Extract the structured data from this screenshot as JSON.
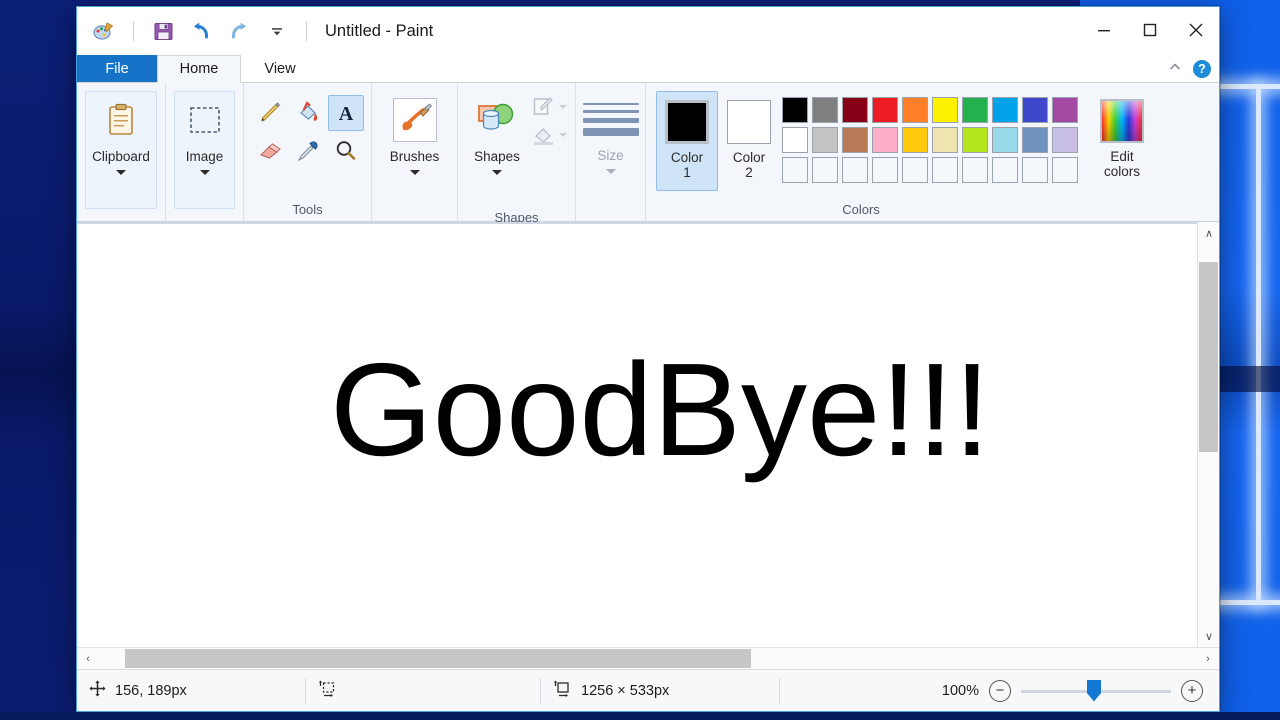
{
  "window": {
    "title": "Untitled - Paint",
    "app_icon": "paint-palette-icon",
    "quick_access": [
      {
        "name": "save-icon",
        "label": "Save"
      },
      {
        "name": "undo-icon",
        "label": "Undo"
      },
      {
        "name": "redo-icon",
        "label": "Redo"
      },
      {
        "name": "customize-qat-icon",
        "label": "Customize Quick Access Toolbar"
      }
    ],
    "controls": {
      "minimize": "Minimize",
      "maximize": "Maximize",
      "close": "Close"
    }
  },
  "tabs": [
    {
      "label": "File",
      "active": false,
      "kind": "file"
    },
    {
      "label": "Home",
      "active": true,
      "kind": "normal"
    },
    {
      "label": "View",
      "active": false,
      "kind": "normal"
    }
  ],
  "ribbon": {
    "collapse_label": "Minimize the Ribbon",
    "help_label": "?",
    "groups": {
      "clipboard": {
        "button_label": "Clipboard",
        "group_label": ""
      },
      "image": {
        "button_label": "Image",
        "group_label": ""
      },
      "tools": {
        "group_label": "Tools",
        "items": [
          {
            "name": "pencil-tool",
            "label": "Pencil",
            "selected": false
          },
          {
            "name": "fill-tool",
            "label": "Fill with color",
            "selected": false
          },
          {
            "name": "text-tool",
            "label": "Text",
            "selected": true
          },
          {
            "name": "eraser-tool",
            "label": "Eraser",
            "selected": false
          },
          {
            "name": "color-picker-tool",
            "label": "Color picker",
            "selected": false
          },
          {
            "name": "magnifier-tool",
            "label": "Magnifier",
            "selected": false
          }
        ]
      },
      "brushes": {
        "button_label": "Brushes"
      },
      "shapes": {
        "group_label": "Shapes",
        "button_label": "Shapes",
        "outline_label": "Outline",
        "fill_label": "Fill"
      },
      "size": {
        "label": "Size",
        "enabled": false
      },
      "colors": {
        "group_label": "Colors",
        "color1_label": "Color",
        "color1_number": "1",
        "color1_value": "#000000",
        "color1_selected": true,
        "color2_label": "Color",
        "color2_number": "2",
        "color2_value": "#ffffff",
        "edit_colors_label_line1": "Edit",
        "edit_colors_label_line2": "colors",
        "palette_row1": [
          "#000000",
          "#7f7f7f",
          "#880015",
          "#ed1c24",
          "#ff7f27",
          "#fff200",
          "#22b14c",
          "#00a2e8",
          "#3f48cc",
          "#a349a4"
        ],
        "palette_row2": [
          "#ffffff",
          "#c3c3c3",
          "#b97a57",
          "#ffaec9",
          "#ffc90e",
          "#efe4b0",
          "#b5e61d",
          "#99d9ea",
          "#7092be",
          "#c8bfe7"
        ],
        "palette_row3": [
          "",
          "",
          "",
          "",
          "",
          "",
          "",
          "",
          "",
          ""
        ]
      }
    }
  },
  "canvas": {
    "text": "GoodBye!!!",
    "background": "#ffffff",
    "text_color": "#000000"
  },
  "scrollbars": {
    "vertical_up": "∧",
    "vertical_down": "∨",
    "horizontal_left": "‹",
    "horizontal_right": "›"
  },
  "status_bar": {
    "cursor_icon": "cursor-position-icon",
    "cursor_position": "156, 189px",
    "selection_icon": "selection-size-icon",
    "selection_size": "",
    "image_icon": "image-size-icon",
    "image_size": "1256 × 533px",
    "zoom_level": "100%",
    "zoom_out_label": "−",
    "zoom_in_label": "+"
  }
}
